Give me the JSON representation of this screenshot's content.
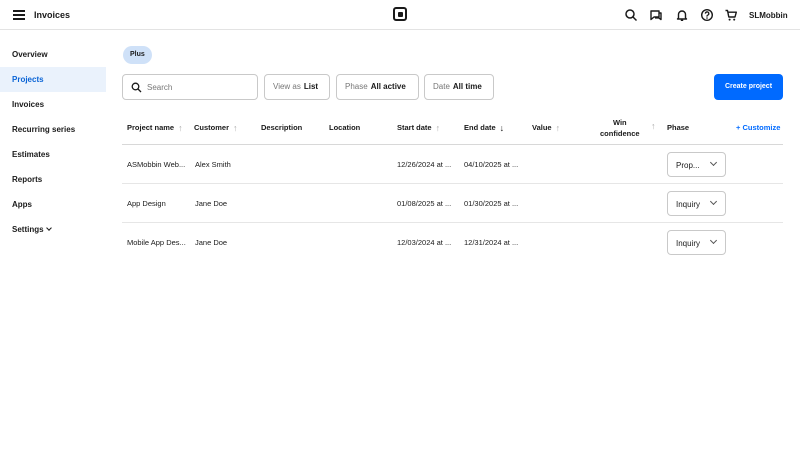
{
  "header": {
    "title": "Invoices",
    "username": "SLMobbin"
  },
  "sidebar": {
    "items": [
      {
        "label": "Overview",
        "active": false
      },
      {
        "label": "Projects",
        "active": true
      },
      {
        "label": "Invoices",
        "active": false
      },
      {
        "label": "Recurring series",
        "active": false
      },
      {
        "label": "Estimates",
        "active": false
      },
      {
        "label": "Reports",
        "active": false
      },
      {
        "label": "Apps",
        "active": false
      },
      {
        "label": "Settings",
        "active": false,
        "has_chevron": true
      }
    ]
  },
  "plan_badge": "Plus",
  "toolbar": {
    "search_placeholder": "Search",
    "view_as_label": "View as",
    "view_as_value": "List",
    "phase_label": "Phase",
    "phase_value": "All active",
    "date_label": "Date",
    "date_value": "All time",
    "create_label": "Create project"
  },
  "table": {
    "columns": {
      "project_name": "Project name",
      "customer": "Customer",
      "description": "Description",
      "location": "Location",
      "start_date": "Start date",
      "end_date": "End date",
      "value": "Value",
      "win_line1": "Win",
      "win_line2": "confidence",
      "phase": "Phase",
      "customize": "+ Customize"
    },
    "rows": [
      {
        "project": "ASMobbin Web...",
        "customer": "Alex Smith",
        "start": "12/26/2024 at ...",
        "end": "04/10/2025 at ...",
        "phase": "Prop..."
      },
      {
        "project": "App Design",
        "customer": "Jane Doe",
        "start": "01/08/2025 at ...",
        "end": "01/30/2025 at ...",
        "phase": "Inquiry"
      },
      {
        "project": "Mobile App Des...",
        "customer": "Jane Doe",
        "start": "12/03/2024 at ...",
        "end": "12/31/2024 at ...",
        "phase": "Inquiry"
      }
    ]
  },
  "colors": {
    "accent": "#006aff",
    "active_nav_bg": "#eaf2fc",
    "badge_bg": "#cfe1f8"
  },
  "icons": [
    "menu-icon",
    "square-logo-icon",
    "search-icon",
    "chat-icon",
    "bell-icon",
    "help-icon",
    "cart-icon"
  ]
}
